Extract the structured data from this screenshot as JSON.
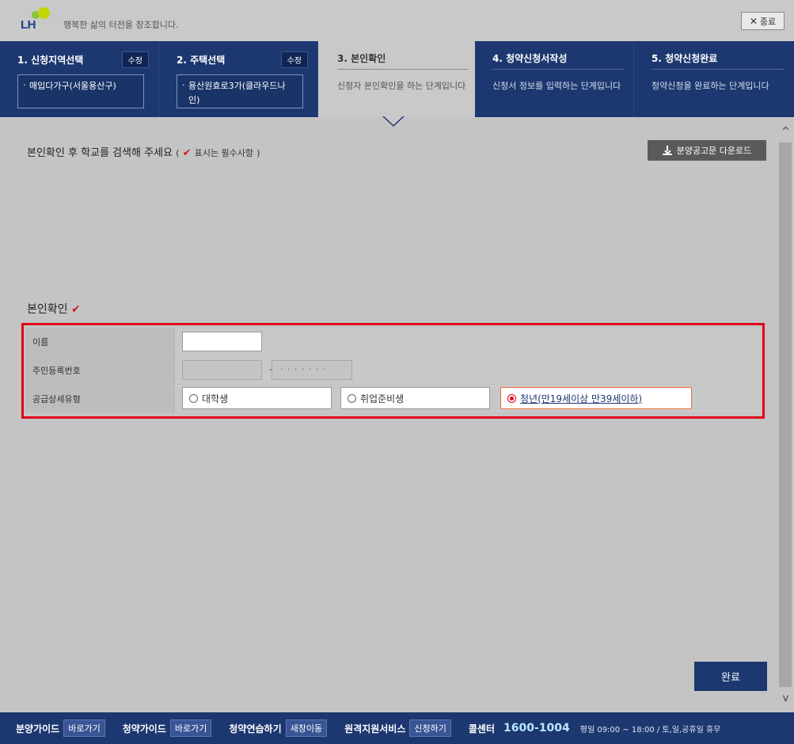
{
  "header": {
    "logo_text": "LH",
    "slogan": "행복한 삶의 터전을 창조합니다.",
    "close_label": "종료"
  },
  "steps": [
    {
      "title": "1. 신청지역선택",
      "badge": "수정",
      "selection": "매입다가구(서울용산구)"
    },
    {
      "title": "2. 주택선택",
      "badge": "수정",
      "selection": "용산원효로3가(클라우드나인)"
    },
    {
      "title": "3. 본인확인",
      "desc": "신청자 본인확인을 하는 단계입니다"
    },
    {
      "title": "4. 청약신청서작성",
      "desc": "신청서 정보를 입력하는 단계입니다"
    },
    {
      "title": "5. 청약신청완료",
      "desc": "청약신청을 완료하는 단계입니다"
    }
  ],
  "active_step": 3,
  "main": {
    "instruction": "본인확인 후 학교를 검색해 주세요",
    "required_open": "(",
    "check_mark": "✔",
    "required_note": "표시는 필수사항",
    "required_close": ")",
    "download_label": "분양공고문 다운로드",
    "section_title": "본인확인",
    "form": {
      "name_label": "이름",
      "name_value": "",
      "rrn_label": "주민등록번호",
      "rrn_front": "",
      "rrn_separator": "-",
      "rrn_back_mask": "· · · · · · ·",
      "type_label": "공급상세유형",
      "type_options": [
        "대학생",
        "취업준비생",
        "청년(만19세이상 만39세이하)"
      ],
      "type_selected": "청년(만19세이상 만39세이하)"
    },
    "submit_label": "완료"
  },
  "scrollbar": {
    "up": "^",
    "down": "v"
  },
  "footer": {
    "items": [
      {
        "label": "분양가이드",
        "button": "바로가기"
      },
      {
        "label": "청약가이드",
        "button": "바로가기"
      },
      {
        "label": "청약연습하기",
        "button": "새창이동"
      },
      {
        "label": "원격지원서비스",
        "button": "신청하기"
      }
    ],
    "call_label": "콜센터",
    "call_number": "1600-1004",
    "hours": "평일 09:00 ~ 18:00 / 토,일,공휴일 휴무"
  },
  "colors": {
    "brand_navy": "#1d3870",
    "highlight_red": "#e0001b",
    "selected_orange": "#ec6d3c"
  }
}
